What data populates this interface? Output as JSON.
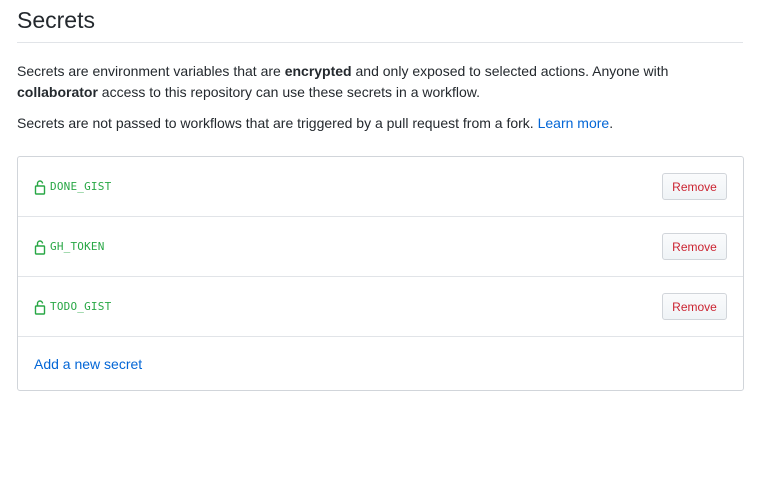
{
  "header": {
    "title": "Secrets"
  },
  "description": {
    "p1_part1": "Secrets are environment variables that are ",
    "p1_bold1": "encrypted",
    "p1_part2": " and only exposed to selected actions. Anyone with ",
    "p1_bold2": "collaborator",
    "p1_part3": " access to this repository can use these secrets in a workflow.",
    "p2_text": "Secrets are not passed to workflows that are triggered by a pull request from a fork. ",
    "p2_link": "Learn more",
    "p2_end": "."
  },
  "secrets": {
    "items": [
      {
        "name": "DONE_GIST",
        "remove_label": "Remove",
        "icon": "lock-icon"
      },
      {
        "name": "GH_TOKEN",
        "remove_label": "Remove",
        "icon": "lock-icon"
      },
      {
        "name": "TODO_GIST",
        "remove_label": "Remove",
        "icon": "lock-icon"
      }
    ],
    "add_label": "Add a new secret"
  },
  "colors": {
    "secret_name": "#28a745",
    "remove_text": "#cb2431",
    "link": "#0366d6"
  }
}
